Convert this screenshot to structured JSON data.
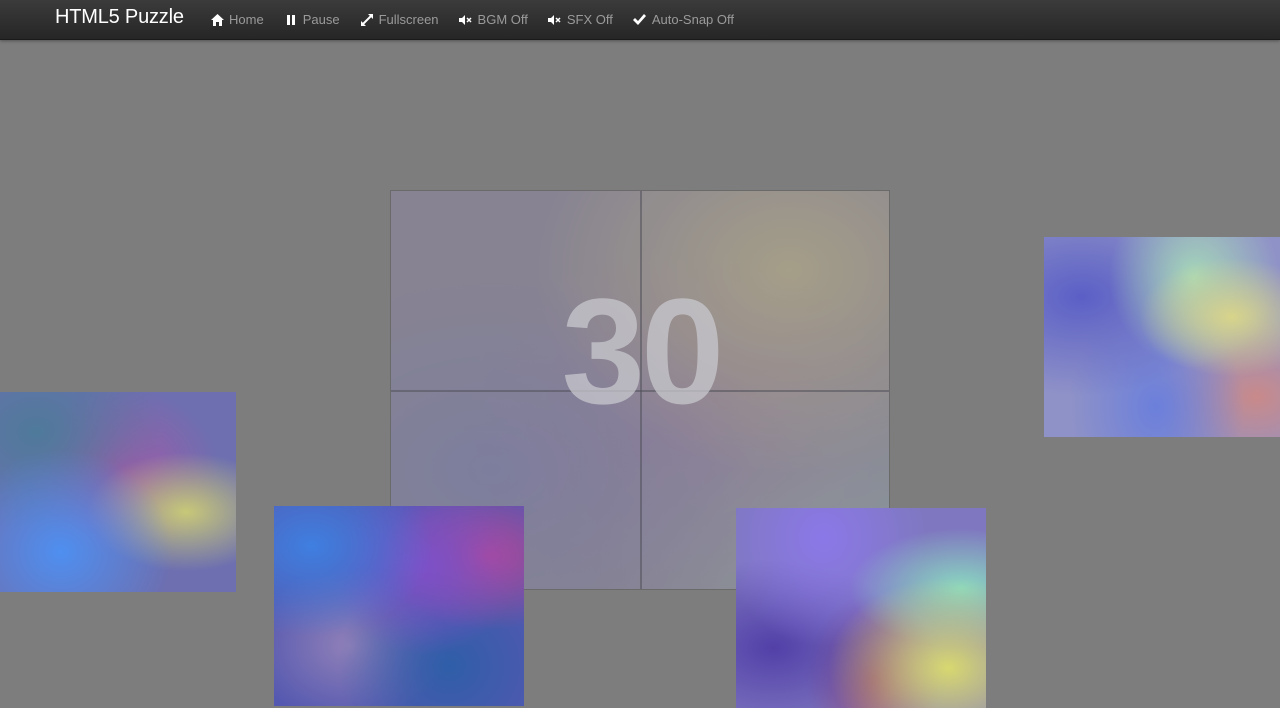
{
  "app": {
    "title": "HTML5 Puzzle"
  },
  "nav": {
    "items": [
      {
        "label": "Home",
        "icon": "home-icon"
      },
      {
        "label": "Pause",
        "icon": "pause-icon"
      },
      {
        "label": "Fullscreen",
        "icon": "fullscreen-icon"
      },
      {
        "label": "BGM Off",
        "icon": "volume-mute-icon"
      },
      {
        "label": "SFX Off",
        "icon": "volume-mute-icon"
      },
      {
        "label": "Auto-Snap Off",
        "icon": "check-icon"
      }
    ]
  },
  "game": {
    "countdown": "30",
    "board_grid": {
      "rows": 2,
      "cols": 2
    },
    "loose_pieces": 4
  },
  "colors": {
    "background": "#7d7d7d",
    "navbar": "#2b2b2b",
    "brand_text": "#ffffff",
    "nav_text": "#9a9a9a",
    "countdown_text": "#c8c8cd"
  }
}
